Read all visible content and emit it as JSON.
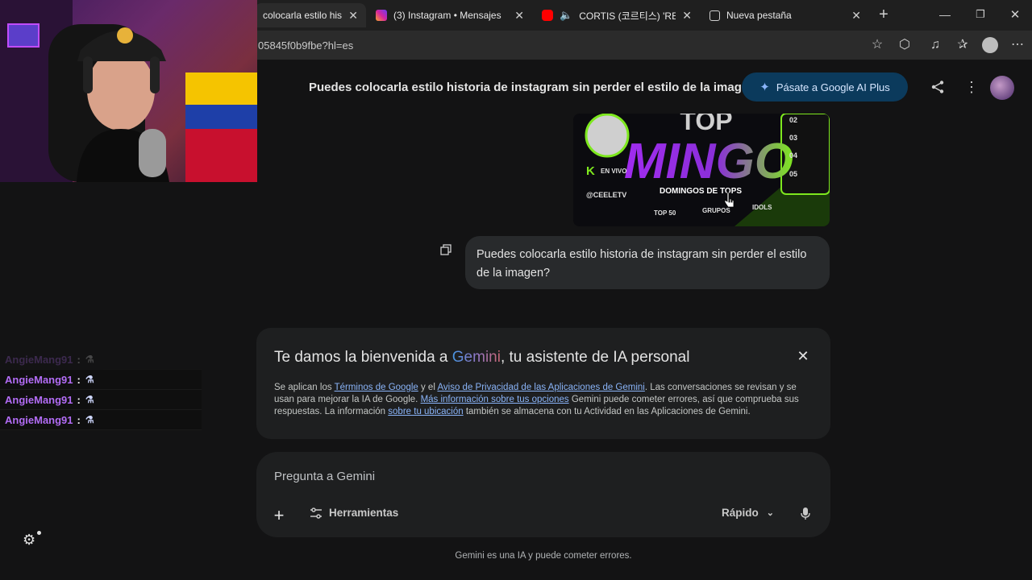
{
  "tabs": [
    {
      "label": "colocarla estilo historia",
      "active": true
    },
    {
      "label": "(3) Instagram • Mensajes",
      "icon": "instagram-icon"
    },
    {
      "label": "CORTIS (코르티스) 'REDRE",
      "icon": "youtube-icon"
    },
    {
      "label": "Nueva pestaña",
      "icon": "new-tab-icon"
    }
  ],
  "address": {
    "url": "05845f0b9fbe?hl=es"
  },
  "gemini": {
    "conversation_title": "Puedes colocarla estilo historia de instagram sin perder el estilo de la imagen",
    "promo_label": "Pásate a Google AI Plus",
    "user_message": "Puedes colocarla estilo historia de instagram sin perder el estilo de la imagen?",
    "image": {
      "logo_text": "MINGO",
      "top_text": "TOP",
      "subtitle": "DOMINGOS DE TOPS",
      "handle": "@CEELETV",
      "live": "EN VIVO",
      "items": [
        "TOP 50",
        "GRUPOS",
        "IDOLS"
      ],
      "numbers": [
        "02",
        "03",
        "04",
        "05"
      ]
    },
    "welcome": {
      "title_prefix": "Te damos la bienvenida a ",
      "title_brand": "Gemini",
      "title_suffix": ", tu asistente de IA personal",
      "t1": "Se aplican los ",
      "link1": "Términos de Google",
      "t2": " y el ",
      "link2": "Aviso de Privacidad de las Aplicaciones de Gemini",
      "t3": ". Las conversaciones se revisan y se usan para mejorar la IA de Google. ",
      "link3": "Más información sobre tus opciones",
      "t4": " Gemini puede cometer errores, así que comprueba sus respuestas. La información ",
      "link4": "sobre tu ubicación",
      "t5": " también se almacena con tu Actividad en las Aplicaciones de Gemini."
    },
    "input": {
      "placeholder": "Pregunta a Gemini",
      "tools_label": "Herramientas",
      "mode_label": "Rápido"
    },
    "disclaimer": "Gemini es una IA y puede cometer errores."
  },
  "chat_overlay": {
    "messages": [
      {
        "user": "AngieMang91",
        "sep": ":"
      },
      {
        "user": "AngieMang91",
        "sep": ":"
      },
      {
        "user": "AngieMang91",
        "sep": ":"
      },
      {
        "user": "AngieMang91",
        "sep": ":"
      }
    ],
    "user_color": "#b26cf5"
  },
  "colors": {
    "accent": "#8ab4f8",
    "promo_bg": "#0b3a5c",
    "neon_green": "#7ee81e",
    "neon_purple": "#a12cf0"
  }
}
